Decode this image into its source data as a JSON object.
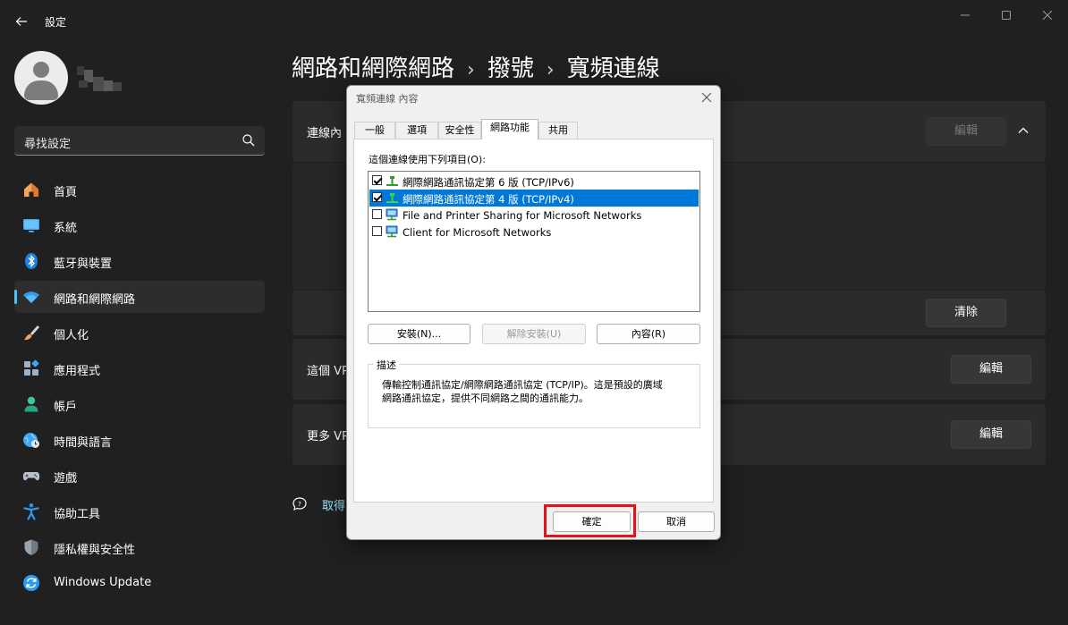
{
  "window": {
    "back_icon": "arrow-left-icon",
    "title": "設定",
    "controls": [
      "minimize-icon",
      "maximize-icon",
      "close-icon"
    ]
  },
  "sidebar": {
    "user": {
      "avatar_icon": "person-icon",
      "name_blurred": true
    },
    "search": {
      "placeholder": "尋找設定",
      "icon": "search-icon"
    },
    "items": [
      {
        "label": "首頁",
        "icon": "home-icon",
        "selected": false
      },
      {
        "label": "系統",
        "icon": "monitor-icon",
        "selected": false
      },
      {
        "label": "藍牙與裝置",
        "icon": "bluetooth-icon",
        "selected": false
      },
      {
        "label": "網路和網際網路",
        "icon": "wifi-icon",
        "selected": true
      },
      {
        "label": "個人化",
        "icon": "brush-icon",
        "selected": false
      },
      {
        "label": "應用程式",
        "icon": "apps-icon",
        "selected": false
      },
      {
        "label": "帳戶",
        "icon": "account-icon",
        "selected": false
      },
      {
        "label": "時間與語言",
        "icon": "globe-clock-icon",
        "selected": false
      },
      {
        "label": "遊戲",
        "icon": "gamepad-icon",
        "selected": false
      },
      {
        "label": "協助工具",
        "icon": "accessibility-icon",
        "selected": false
      },
      {
        "label": "隱私權與安全性",
        "icon": "shield-icon",
        "selected": false
      },
      {
        "label": "Windows Update",
        "icon": "update-icon",
        "selected": false
      }
    ]
  },
  "main": {
    "breadcrumb": [
      "網路和網際網路",
      "撥號",
      "寬頻連線"
    ],
    "cards": {
      "connection_label": "連線內",
      "edit_disabled_label": "編輯",
      "clear_label": "清除",
      "vpn_label": "這個 VP",
      "vpn_edit_label": "編輯",
      "more_vpn_label": "更多 VP",
      "more_vpn_edit_label": "編輯"
    },
    "help_link": "取得"
  },
  "dialog": {
    "title": "寬頻連線 內容",
    "tabs": [
      "一般",
      "選項",
      "安全性",
      "網路功能",
      "共用"
    ],
    "active_tab": "網路功能",
    "list_caption": "這個連線使用下列項目(O):",
    "items": [
      {
        "label": "網際網路通訊協定第 6 版 (TCP/IPv6)",
        "checked": true,
        "selected": false,
        "icon": "protocol-icon"
      },
      {
        "label": "網際網路通訊協定第 4 版 (TCP/IPv4)",
        "checked": true,
        "selected": true,
        "icon": "protocol-icon"
      },
      {
        "label": "File and Printer Sharing for Microsoft Networks",
        "checked": false,
        "selected": false,
        "icon": "network-service-icon"
      },
      {
        "label": "Client for Microsoft Networks",
        "checked": false,
        "selected": false,
        "icon": "network-client-icon"
      }
    ],
    "buttons": {
      "install": "安裝(N)...",
      "uninstall": "解除安裝(U)",
      "properties": "內容(R)"
    },
    "description": {
      "legend": "描述",
      "line1": "傳輸控制通訊協定/網際網路通訊協定 (TCP/IP)。這是預設的廣域",
      "line2": "網路通訊協定，提供不同網路之間的通訊能力。"
    },
    "ok": "確定",
    "cancel": "取消"
  },
  "colors": {
    "background": "#202020",
    "card": "#2b2b2b",
    "accent": "#4cc2ff",
    "selection": "#0078d7",
    "highlight_box": "#e0141e"
  }
}
